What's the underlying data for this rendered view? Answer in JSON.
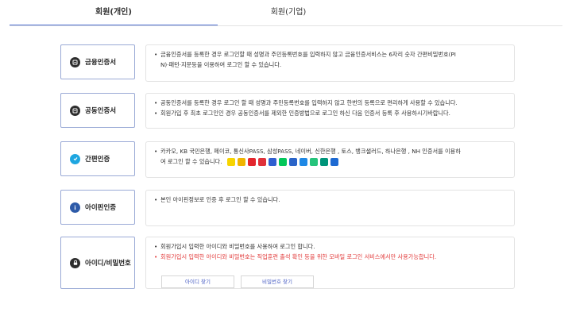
{
  "tabs": [
    {
      "label": "회원(개인)",
      "active": true
    },
    {
      "label": "회원(기업)",
      "active": false
    }
  ],
  "methods": [
    {
      "label": "금융인증서",
      "icon": "certificate-icon",
      "lines": [
        "금융인증서를 등록한 경우 로그인할 때 성명과 주민등록번호를 입력하지 않고 금융인증서비스는 6자리 숫자 간편비밀번호(PI",
        "N)·패턴·지문등을 이용하여 로그인 할 수 있습니다."
      ]
    },
    {
      "label": "공동인증서",
      "icon": "certificate-icon",
      "lines": [
        "공동인증서를 등록한 경우 로그인 할 때 성명과 주민등록번호를 입력하지 않고 한번의 등록으로 편리하게 사용할 수 있습니다.",
        "회원가입 후 최초 로그인인 경우 공동인증서를 제외한 인증방법으로 로그인 하신 다음 인증서 등록 후 사용하시기바랍니다."
      ]
    },
    {
      "label": "간편인증",
      "icon": "shield-check-icon",
      "lines": [
        "카카오, KB 국민은행, 페이코, 통신사PASS, 삼성PASS, 네이버, 신한은행 , 토스, 뱅크샐러드, 하나은행 , NH 인증서를 이용하",
        "여 로그인 할 수 있습니다."
      ]
    },
    {
      "label": "아이핀인증",
      "icon": "info-icon",
      "lines": [
        "본인 아이핀정보로 인증 후 로그인 할 수 있습니다."
      ]
    },
    {
      "label": "아이디/비밀번호",
      "icon": "lock-icon",
      "lines": [
        "회원가입시 입력한 아이디와 비밀번호를 사용하여 로그인 합니다.",
        "회원가입시 입력한 아이디와 비밀번호는 직업훈련 출석 확인 등을 위한 모바일 로그인 서비스에서만 사용가능합니다."
      ],
      "buttons": {
        "find_id": "아이디 찾기",
        "find_pw": "비밀번호 찾기"
      }
    }
  ],
  "provider_logos": [
    {
      "name": "kakao-logo-icon",
      "color": "#f7d400"
    },
    {
      "name": "kb-logo-icon",
      "color": "#f0b400"
    },
    {
      "name": "payco-logo-icon",
      "color": "#e3262d"
    },
    {
      "name": "pass-logo-icon",
      "color": "#e0313a"
    },
    {
      "name": "samsung-pass-logo-icon",
      "color": "#2f5fd0"
    },
    {
      "name": "naver-logo-icon",
      "color": "#03c75a"
    },
    {
      "name": "shinhan-logo-icon",
      "color": "#2a64c8"
    },
    {
      "name": "toss-logo-icon",
      "color": "#1e88e5"
    },
    {
      "name": "banksalad-logo-icon",
      "color": "#25c37b"
    },
    {
      "name": "hana-logo-icon",
      "color": "#00957a"
    },
    {
      "name": "nh-logo-icon",
      "color": "#1d6ad2"
    }
  ],
  "colors": {
    "accent": "#4a6bd0",
    "method_border": "#9aaad6",
    "warning": "#e23a3a"
  }
}
